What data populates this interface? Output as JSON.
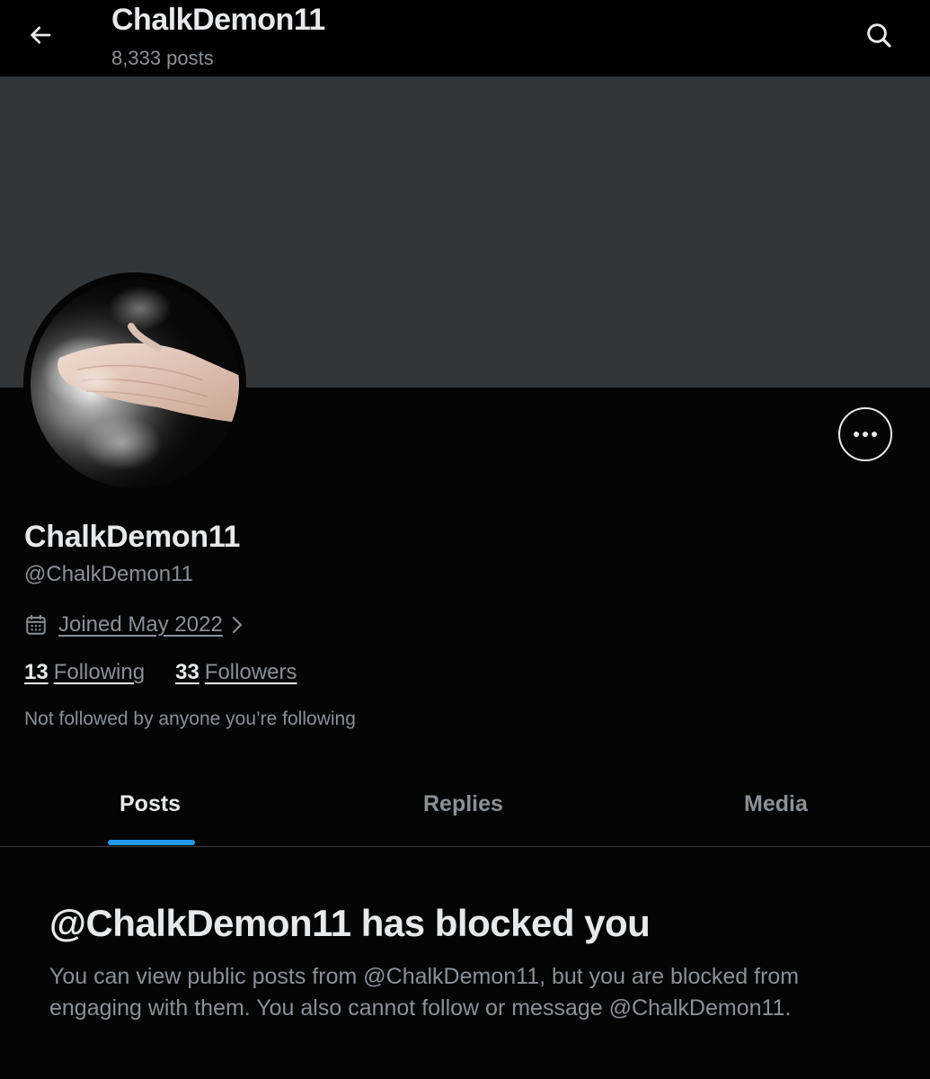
{
  "header": {
    "title": "ChalkDemon11",
    "post_count": "8,333 posts",
    "back_icon": "arrow-left-icon",
    "search_icon": "search-icon"
  },
  "profile": {
    "display_name": "ChalkDemon11",
    "handle": "@ChalkDemon11",
    "joined": "Joined May 2022",
    "following_count": "13",
    "following_label": "Following",
    "followers_count": "33",
    "followers_label": "Followers",
    "mutuals_note": "Not followed by anyone you’re following"
  },
  "tabs": [
    {
      "label": "Posts",
      "active": true
    },
    {
      "label": "Replies",
      "active": false
    },
    {
      "label": "Media",
      "active": false
    }
  ],
  "blocked": {
    "title": "@ChalkDemon11 has blocked you",
    "message": "You can view public posts from @ChalkDemon11, but you are blocked from engaging with them. You also cannot follow or message @ChalkDemon11."
  },
  "colors": {
    "background": "#050505",
    "banner": "#333639",
    "accent": "#1d9bf0",
    "primary_text": "#e7e9ea",
    "secondary_text": "#8b9096"
  }
}
